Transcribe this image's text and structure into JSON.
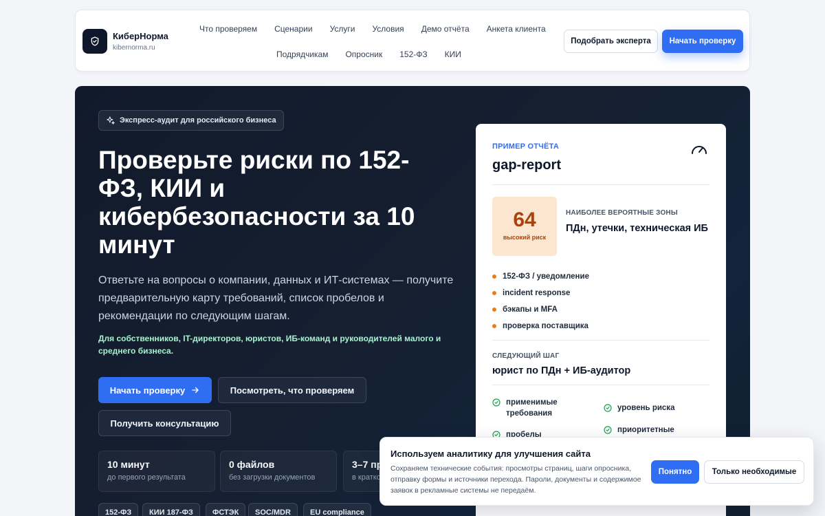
{
  "header": {
    "brand_name": "КиберНорма",
    "brand_url": "kibernorma.ru",
    "nav_row1": [
      "Что проверяем",
      "Сценарии",
      "Услуги",
      "Условия",
      "Демо отчёта",
      "Анкета клиента"
    ],
    "nav_row2": [
      "Подрядчикам",
      "Опросник",
      "152-ФЗ",
      "КИИ"
    ],
    "btn_expert": "Подобрать эксперта",
    "btn_start": "Начать проверку"
  },
  "hero": {
    "badge": "Экспресс-аудит для российского бизнеса",
    "title": "Проверьте риски по 152-ФЗ, КИИ и кибербезопасности за 10 минут",
    "subtitle": "Ответьте на вопросы о компании, данных и ИТ-системах — получите предварительную карту требований, список пробелов и рекомендации по следующим шагам.",
    "audience": "Для собственников, IT-директоров, юристов, ИБ-команд и руководителей малого и среднего бизнеса.",
    "btn_start": "Начать проверку",
    "btn_what": "Посмотреть, что проверяем",
    "btn_consult": "Получить консультацию",
    "stats": [
      {
        "value": "10 минут",
        "label": "до первого результата"
      },
      {
        "value": "0 файлов",
        "label": "без загрузки документов"
      },
      {
        "value": "3–7 пр",
        "label": "в кратко"
      }
    ],
    "chips": [
      "152-ФЗ",
      "КИИ 187-ФЗ",
      "ФСТЭК",
      "SOC/MDR",
      "EU compliance"
    ]
  },
  "report": {
    "eyebrow": "ПРИМЕР ОТЧЁТА",
    "title": "gap-report",
    "score": "64",
    "score_label": "высокий риск",
    "zones_caption": "НАИБОЛЕЕ ВЕРОЯТНЫЕ ЗОНЫ",
    "zones_value": "ПДн, утечки, техническая ИБ",
    "risks": [
      "152-ФЗ / уведомление",
      "incident response",
      "бэкапы и MFA",
      "проверка поставщика"
    ],
    "next_caption": "СЛЕДУЮЩИЙ ШАГ",
    "next_value": "юрист по ПДн + ИБ-аудитор",
    "checks": [
      "применимые требования",
      "уровень риска",
      "пробелы",
      "приоритетные"
    ],
    "accent": "#2f6df2",
    "risk_color": "#ea7a17",
    "check_color": "#16a34a"
  },
  "cookie": {
    "title": "Используем аналитику для улучшения сайта",
    "text": "Сохраняем технические события: просмотры страниц, шаги опросника, отправку формы и источники перехода. Пароли, документы и содержимое заявок в рекламные системы не передаём.",
    "btn_ok": "Понятно",
    "btn_necessary": "Только необходимые"
  }
}
